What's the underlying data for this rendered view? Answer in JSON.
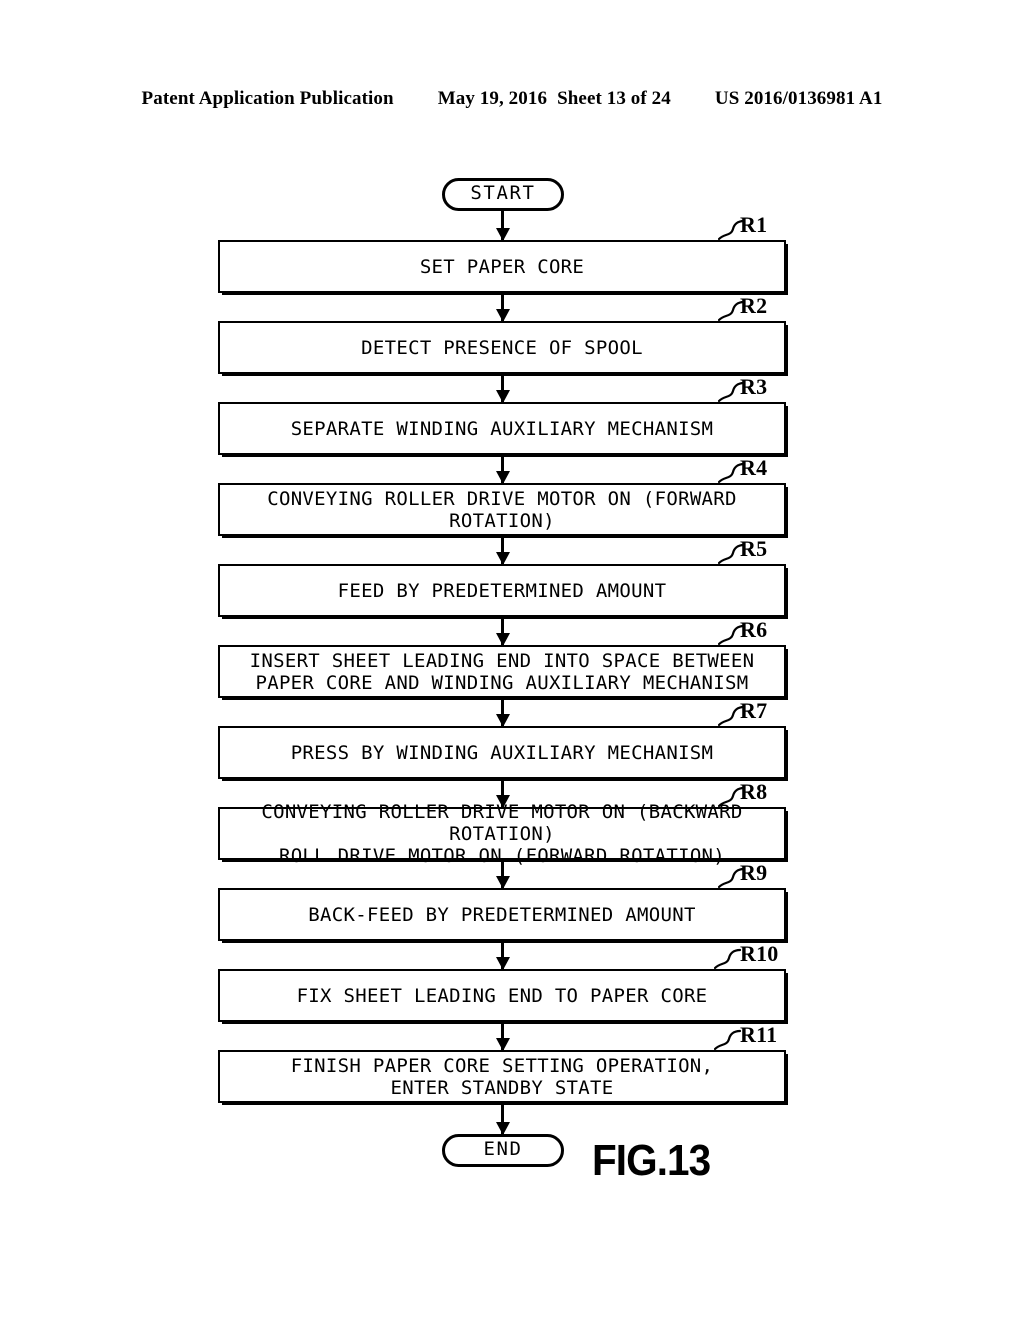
{
  "header": {
    "publication": "Patent Application Publication",
    "date": "May 19, 2016",
    "sheet": "Sheet 13 of 24",
    "publication_number": "US 2016/0136981 A1"
  },
  "figure": {
    "caption": "FIG.13"
  },
  "flowchart": {
    "start_label": "START",
    "end_label": "END",
    "steps": [
      {
        "ref": "R1",
        "text": "SET PAPER CORE",
        "lines": 1
      },
      {
        "ref": "R2",
        "text": "DETECT PRESENCE OF SPOOL",
        "lines": 1
      },
      {
        "ref": "R3",
        "text": "SEPARATE WINDING AUXILIARY MECHANISM",
        "lines": 1
      },
      {
        "ref": "R4",
        "text": "CONVEYING ROLLER DRIVE MOTOR ON (FORWARD ROTATION)",
        "lines": 1
      },
      {
        "ref": "R5",
        "text": "FEED BY PREDETERMINED AMOUNT",
        "lines": 1
      },
      {
        "ref": "R6",
        "text": "INSERT SHEET LEADING END INTO SPACE BETWEEN\nPAPER CORE AND WINDING AUXILIARY MECHANISM",
        "lines": 2
      },
      {
        "ref": "R7",
        "text": "PRESS BY WINDING AUXILIARY MECHANISM",
        "lines": 1
      },
      {
        "ref": "R8",
        "text": "CONVEYING ROLLER DRIVE MOTOR ON (BACKWARD ROTATION)\nROLL DRIVE MOTOR ON (FORWARD ROTATION)",
        "lines": 2
      },
      {
        "ref": "R9",
        "text": "BACK-FEED BY PREDETERMINED AMOUNT",
        "lines": 1
      },
      {
        "ref": "R10",
        "text": "FIX SHEET LEADING END TO PAPER CORE",
        "lines": 1
      },
      {
        "ref": "R11",
        "text": "FINISH PAPER CORE SETTING OPERATION,\nENTER STANDBY STATE",
        "lines": 2
      }
    ]
  },
  "colors": {
    "ink": "#000000",
    "paper": "#ffffff"
  }
}
